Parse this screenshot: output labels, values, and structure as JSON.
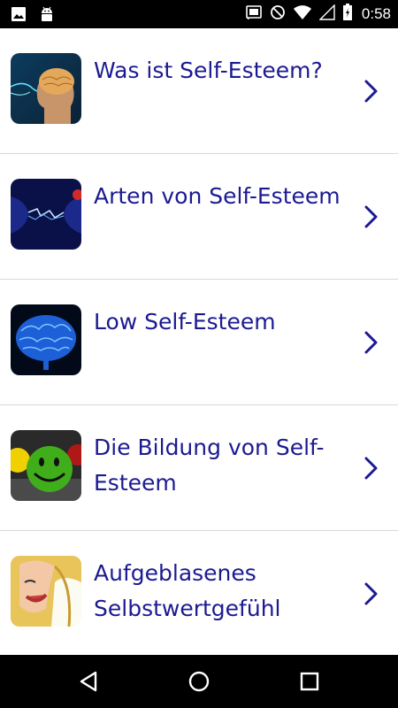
{
  "status_bar": {
    "time": "0:58",
    "left_icons": [
      "image-icon",
      "android-icon"
    ],
    "right_icons": [
      "cast-icon",
      "do-not-disturb-icon",
      "wifi-icon",
      "signal-icon",
      "battery-icon"
    ]
  },
  "list": {
    "items": [
      {
        "title": "Was ist Self-Esteem?",
        "icon": "brain-head-image"
      },
      {
        "title": "Arten von Self-Esteem",
        "icon": "electric-faces-image"
      },
      {
        "title": "Low Self-Esteem",
        "icon": "blue-brain-image"
      },
      {
        "title": "Die Bildung von Self-Esteem",
        "icon": "smiley-balls-image"
      },
      {
        "title": "Aufgeblasenes Selbstwertgefühl",
        "icon": "laughing-woman-image"
      }
    ]
  },
  "colors": {
    "title_text": "#1c1a91",
    "chevron": "#1c1a91",
    "divider": "#d9d9d9",
    "status_bar": "#000000",
    "nav_bar": "#000000"
  },
  "nav_bar": {
    "buttons": [
      "back-icon",
      "home-icon",
      "recents-icon"
    ]
  }
}
